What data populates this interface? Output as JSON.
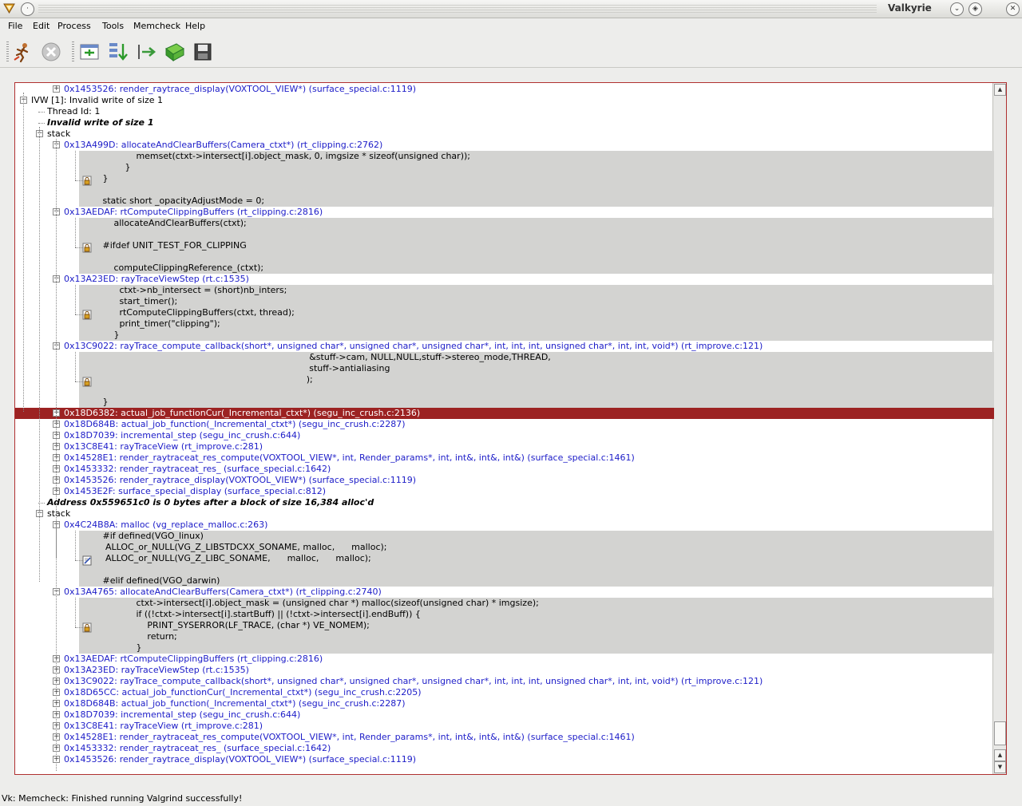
{
  "window": {
    "title": "Valkyrie"
  },
  "menu": [
    {
      "label": "File",
      "name": "menu-file"
    },
    {
      "label": "Edit",
      "name": "menu-edit"
    },
    {
      "label": "Process",
      "name": "menu-process"
    },
    {
      "label": "Tools",
      "name": "menu-tools"
    },
    {
      "label": "Memcheck",
      "name": "menu-memcheck"
    },
    {
      "label": "Help",
      "name": "menu-help"
    }
  ],
  "toolbar": {
    "buttons": [
      {
        "name": "run-valgrind-button",
        "icon": "running-man-icon"
      },
      {
        "name": "stop-button",
        "icon": "stop-icon"
      },
      {
        "name": "open-all-button",
        "icon": "expand-all-icon"
      },
      {
        "name": "open-one-button",
        "icon": "expand-one-icon"
      },
      {
        "name": "show-src-button",
        "icon": "goto-source-icon"
      },
      {
        "name": "open-log-button",
        "icon": "open-log-icon"
      },
      {
        "name": "save-log-button",
        "icon": "save-icon"
      }
    ]
  },
  "tree": {
    "rows": [
      {
        "indent": 3,
        "exp": "+",
        "text": "0x1453526: render_raytrace_display(VOXTOOL_VIEW*) (surface_special.c:1119)",
        "style": "blue"
      },
      {
        "indent": 1,
        "exp": "-",
        "text": "IVW [1]: Invalid write of size 1",
        "style": "plain"
      },
      {
        "indent": 2,
        "exp": "",
        "text": "Thread Id: 1",
        "style": "plain"
      },
      {
        "indent": 2,
        "exp": "",
        "text": "Invalid write of size 1",
        "style": "bi"
      },
      {
        "indent": 2,
        "exp": "-",
        "text": "stack",
        "style": "plain"
      },
      {
        "indent": 3,
        "exp": "-",
        "text": "0x13A499D: allocateAndClearBuffers(Camera_ctxt*) (rt_clipping.c:2762)",
        "style": "blue"
      },
      {
        "code": [
          "                 memset(ctxt->intersect[i].object_mask, 0, imgsize * sizeof(unsigned char));",
          "             }",
          "     }",
          "",
          "     static short _opacityAdjustMode = 0;"
        ],
        "icon": "lock"
      },
      {
        "indent": 3,
        "exp": "-",
        "text": "0x13AEDAF: rtComputeClippingBuffers (rt_clipping.c:2816)",
        "style": "blue"
      },
      {
        "code": [
          "         allocateAndClearBuffers(ctxt);",
          "",
          "     #ifdef UNIT_TEST_FOR_CLIPPING",
          "",
          "         computeClippingReference_(ctxt);"
        ],
        "icon": "lock"
      },
      {
        "indent": 3,
        "exp": "-",
        "text": "0x13A23ED: rayTraceViewStep (rt.c:1535)",
        "style": "blue"
      },
      {
        "code": [
          "           ctxt->nb_intersect = (short)nb_inters;",
          "           start_timer();",
          "           rtComputeClippingBuffers(ctxt, thread);",
          "           print_timer(\"clipping\");",
          "         }"
        ],
        "icon": "lock"
      },
      {
        "indent": 3,
        "exp": "-",
        "text": "0x13C9022: rayTrace_compute_callback(short*, unsigned char*, unsigned char*, unsigned char*, int, int, int, unsigned char*, int, int, void*) (rt_improve.c:121)",
        "style": "blue"
      },
      {
        "code": [
          "                                                                               &stuff->cam, NULL,NULL,stuff->stereo_mode,THREAD,",
          "                                                                               stuff->antialiasing",
          "                                                                              );",
          "",
          "     }"
        ],
        "icon": "lock"
      },
      {
        "indent": 3,
        "exp": "+",
        "text": "0x18D6382: actual_job_functionCur(_Incremental_ctxt*) (segu_inc_crush.c:2136)",
        "style": "blue",
        "selected": true
      },
      {
        "indent": 3,
        "exp": "+",
        "text": "0x18D684B: actual_job_function(_Incremental_ctxt*) (segu_inc_crush.c:2287)",
        "style": "blue"
      },
      {
        "indent": 3,
        "exp": "+",
        "text": "0x18D7039: incremental_step (segu_inc_crush.c:644)",
        "style": "blue"
      },
      {
        "indent": 3,
        "exp": "+",
        "text": "0x13C8E41: rayTraceView (rt_improve.c:281)",
        "style": "blue"
      },
      {
        "indent": 3,
        "exp": "+",
        "text": "0x14528E1: render_raytraceat_res_compute(VOXTOOL_VIEW*, int, Render_params*, int, int&, int&, int&) (surface_special.c:1461)",
        "style": "blue"
      },
      {
        "indent": 3,
        "exp": "+",
        "text": "0x1453332: render_raytraceat_res_ (surface_special.c:1642)",
        "style": "blue"
      },
      {
        "indent": 3,
        "exp": "+",
        "text": "0x1453526: render_raytrace_display(VOXTOOL_VIEW*) (surface_special.c:1119)",
        "style": "blue"
      },
      {
        "indent": 3,
        "exp": "+",
        "text": "0x1453E2F: surface_special_display (surface_special.c:812)",
        "style": "blue"
      },
      {
        "indent": 2,
        "exp": "",
        "text": "Address 0x559651c0 is 0 bytes after a block of size 16,384 alloc'd",
        "style": "bi"
      },
      {
        "indent": 2,
        "exp": "-",
        "text": "stack",
        "style": "plain"
      },
      {
        "indent": 3,
        "exp": "-",
        "text": "0x4C24B8A: malloc (vg_replace_malloc.c:263)",
        "style": "blue"
      },
      {
        "code": [
          "     #if defined(VGO_linux)",
          "      ALLOC_or_NULL(VG_Z_LIBSTDCXX_SONAME, malloc,      malloc);",
          "      ALLOC_or_NULL(VG_Z_LIBC_SONAME,      malloc,      malloc);",
          "",
          "     #elif defined(VGO_darwin)"
        ],
        "icon": "edit"
      },
      {
        "indent": 3,
        "exp": "-",
        "text": "0x13A4765: allocateAndClearBuffers(Camera_ctxt*) (rt_clipping.c:2740)",
        "style": "blue"
      },
      {
        "code": [
          "                 ctxt->intersect[i].object_mask = (unsigned char *) malloc(sizeof(unsigned char) * imgsize);",
          "                 if ((!ctxt->intersect[i].startBuff) || (!ctxt->intersect[i].endBuff)) {",
          "                     PRINT_SYSERROR(LF_TRACE, (char *) VE_NOMEM);",
          "                     return;",
          "                 }"
        ],
        "icon": "lock"
      },
      {
        "indent": 3,
        "exp": "+",
        "text": "0x13AEDAF: rtComputeClippingBuffers (rt_clipping.c:2816)",
        "style": "blue"
      },
      {
        "indent": 3,
        "exp": "+",
        "text": "0x13A23ED: rayTraceViewStep (rt.c:1535)",
        "style": "blue"
      },
      {
        "indent": 3,
        "exp": "+",
        "text": "0x13C9022: rayTrace_compute_callback(short*, unsigned char*, unsigned char*, unsigned char*, int, int, int, unsigned char*, int, int, void*) (rt_improve.c:121)",
        "style": "blue"
      },
      {
        "indent": 3,
        "exp": "+",
        "text": "0x18D65CC: actual_job_functionCur(_Incremental_ctxt*) (segu_inc_crush.c:2205)",
        "style": "blue"
      },
      {
        "indent": 3,
        "exp": "+",
        "text": "0x18D684B: actual_job_function(_Incremental_ctxt*) (segu_inc_crush.c:2287)",
        "style": "blue"
      },
      {
        "indent": 3,
        "exp": "+",
        "text": "0x18D7039: incremental_step (segu_inc_crush.c:644)",
        "style": "blue"
      },
      {
        "indent": 3,
        "exp": "+",
        "text": "0x13C8E41: rayTraceView (rt_improve.c:281)",
        "style": "blue"
      },
      {
        "indent": 3,
        "exp": "+",
        "text": "0x14528E1: render_raytraceat_res_compute(VOXTOOL_VIEW*, int, Render_params*, int, int&, int&, int&) (surface_special.c:1461)",
        "style": "blue"
      },
      {
        "indent": 3,
        "exp": "+",
        "text": "0x1453332: render_raytraceat_res_ (surface_special.c:1642)",
        "style": "blue"
      },
      {
        "indent": 3,
        "exp": "+",
        "text": "0x1453526: render_raytrace_display(VOXTOOL_VIEW*) (surface_special.c:1119)",
        "style": "blue"
      }
    ]
  },
  "status": {
    "text": "Vk: Memcheck: Finished running Valgrind successfully!"
  },
  "colors": {
    "selection": "#9c2222",
    "frame_link": "#1c1cc8",
    "source_bg": "#d3d3d1"
  }
}
